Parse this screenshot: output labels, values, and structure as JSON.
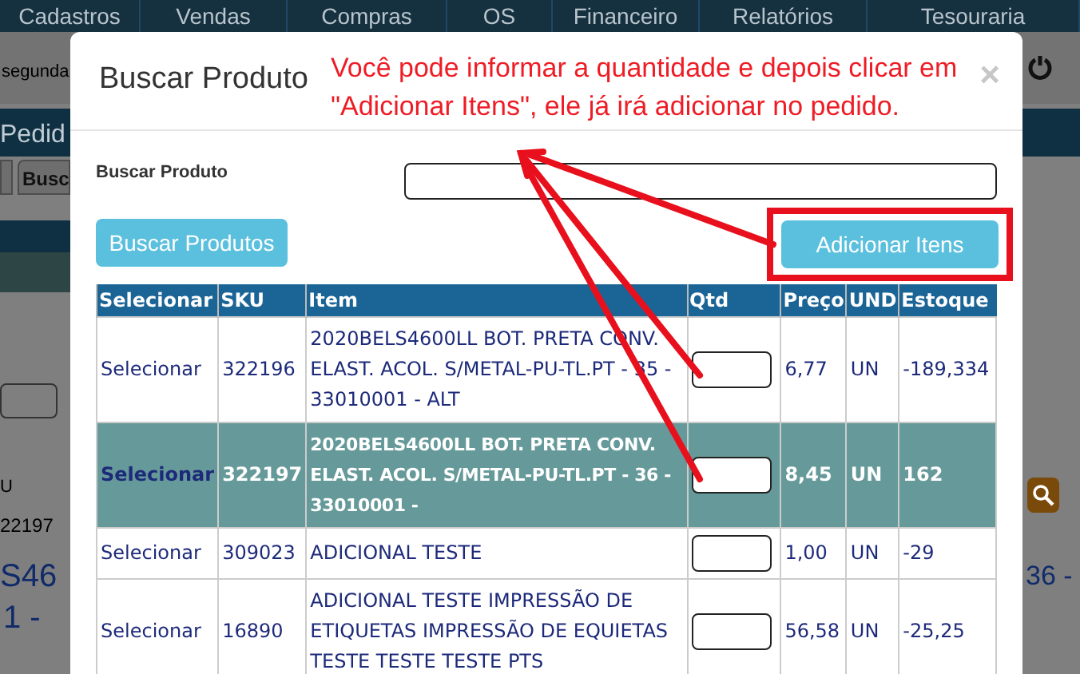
{
  "nav": [
    {
      "label": "Cadastros"
    },
    {
      "label": "Vendas"
    },
    {
      "label": "Compras"
    },
    {
      "label": "OS"
    },
    {
      "label": "Financeiro"
    },
    {
      "label": "Relatórios"
    },
    {
      "label": "Tesouraria"
    }
  ],
  "background": {
    "user_text": "segunda",
    "page_title": "Pedid",
    "tab": "Busc",
    "column_label": "U",
    "sku": "22197",
    "product_line_1": "S46",
    "product_line_2": "1 -",
    "right_text": "36 -"
  },
  "modal": {
    "title": "Buscar Produto",
    "annotation": [
      "Você pode informar a quantidade e depois clicar em",
      "\"Adicionar Itens\", ele já irá adicionar no pedido."
    ],
    "close": "×",
    "search_label": "Buscar Produto",
    "search_button": "Buscar Produtos",
    "add_button": "Adicionar Itens",
    "columns": [
      "Selecionar",
      "SKU",
      "Item",
      "Qtd",
      "Preço",
      "UND",
      "Estoque"
    ],
    "rows": [
      {
        "select": "Selecionar",
        "sku": "322196",
        "item": "2020BELS4600LL BOT. PRETA CONV. ELAST. ACOL. S/METAL-PU-TL.PT - 35 - 33010001 - ALT",
        "price": "6,77",
        "unit": "UN",
        "stock": "-189,334",
        "selected": false
      },
      {
        "select": "Selecionar",
        "sku": "322197",
        "item": "2020BELS4600LL BOT. PRETA CONV. ELAST. ACOL. S/METAL-PU-TL.PT - 36 - 33010001 -",
        "price": "8,45",
        "unit": "UN",
        "stock": "162",
        "selected": true
      },
      {
        "select": "Selecionar",
        "sku": "309023",
        "item": "ADICIONAL TESTE",
        "price": "1,00",
        "unit": "UN",
        "stock": "-29",
        "selected": false
      },
      {
        "select": "Selecionar",
        "sku": "16890",
        "item": "ADICIONAL TESTE IMPRESSÃO DE ETIQUETAS IMPRESSÃO DE EQUIETAS TESTE TESTE TESTE PTS",
        "price": "56,58",
        "unit": "UN",
        "stock": "-25,25",
        "selected": false
      }
    ]
  }
}
